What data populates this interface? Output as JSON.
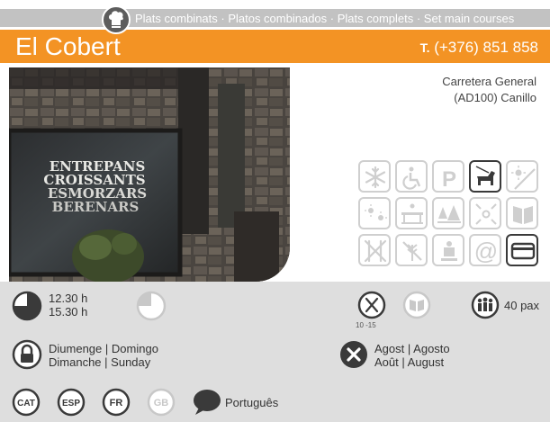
{
  "category": {
    "text": "Plats combinats · Platos combinados · Plats complets · Set main courses"
  },
  "header": {
    "title": "El Cobert",
    "phone_prefix": "T.",
    "phone": "(+376) 851 858"
  },
  "address": {
    "line1": "Carretera General",
    "line2": "(AD100) Canillo"
  },
  "photo": {
    "window_lines": [
      "ENTREPANS",
      "CROISSANTS",
      "ESMORZARS",
      "BERENARS"
    ]
  },
  "amenities": [
    {
      "name": "air-conditioning",
      "active": false
    },
    {
      "name": "wheelchair-access",
      "active": false
    },
    {
      "name": "parking",
      "active": false,
      "label": "P"
    },
    {
      "name": "pets-allowed",
      "active": true
    },
    {
      "name": "no-terrace",
      "active": false
    },
    {
      "name": "terrace",
      "active": false
    },
    {
      "name": "bridge-view",
      "active": false
    },
    {
      "name": "forest-view",
      "active": false
    },
    {
      "name": "children-area",
      "active": false
    },
    {
      "name": "menu",
      "active": false
    },
    {
      "name": "no-cutlery",
      "active": false
    },
    {
      "name": "gluten-free",
      "active": false
    },
    {
      "name": "chef",
      "active": false
    },
    {
      "name": "wifi",
      "active": false,
      "label": "@"
    },
    {
      "name": "card-payment",
      "active": true
    }
  ],
  "hours": {
    "open": "12.30 h",
    "close": "15.30 h"
  },
  "price": {
    "range": "10 -15"
  },
  "capacity": {
    "text": "40 pax"
  },
  "closed_day": {
    "line1_a": "Diumenge",
    "line1_b": "Domingo",
    "line2_a": "Dimanche",
    "line2_b": "Sunday",
    "sep": "|"
  },
  "vacation": {
    "line1_a": "Agost",
    "line1_b": "Agosto",
    "line2_a": "Août",
    "line2_b": "August",
    "sep": "|"
  },
  "languages": {
    "cat": "CAT",
    "esp": "ESP",
    "fr": "FR",
    "gb": "GB",
    "other": "Português"
  }
}
